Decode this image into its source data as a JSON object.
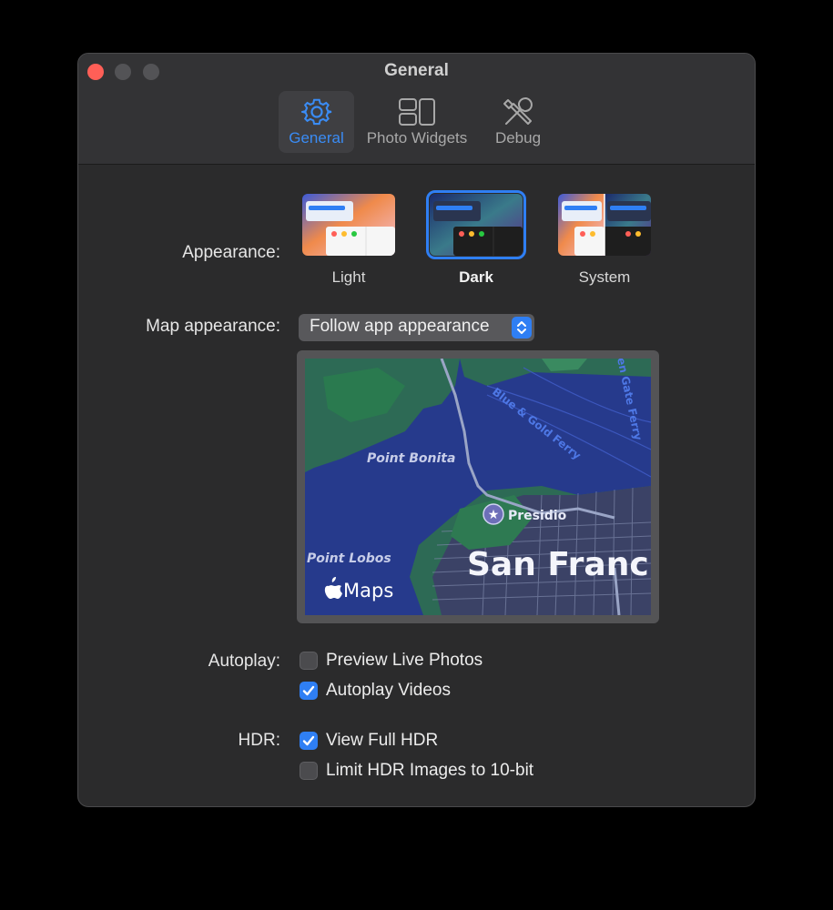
{
  "window": {
    "title": "General"
  },
  "toolbar": {
    "tabs": [
      {
        "label": "General",
        "icon": "gear-icon",
        "active": true
      },
      {
        "label": "Photo Widgets",
        "icon": "widgets-icon",
        "active": false
      },
      {
        "label": "Debug",
        "icon": "wrench-screwdriver-icon",
        "active": false
      }
    ]
  },
  "appearance": {
    "label": "Appearance:",
    "options": [
      {
        "label": "Light",
        "selected": false
      },
      {
        "label": "Dark",
        "selected": true
      },
      {
        "label": "System",
        "selected": false
      }
    ]
  },
  "map_appearance": {
    "label": "Map appearance:",
    "value": "Follow app appearance",
    "preview": {
      "place_labels": [
        "Point Bonita",
        "Point Lobos",
        "Presidio",
        "San Franci"
      ],
      "route_labels": [
        "Blue & Gold Ferry",
        "en Gate Ferry"
      ],
      "brand": "Maps"
    }
  },
  "autoplay": {
    "label": "Autoplay:",
    "options": [
      {
        "label": "Preview Live Photos",
        "checked": false
      },
      {
        "label": "Autoplay Videos",
        "checked": true
      }
    ]
  },
  "hdr": {
    "label": "HDR:",
    "options": [
      {
        "label": "View Full HDR",
        "checked": true
      },
      {
        "label": "Limit HDR Images to 10-bit",
        "checked": false
      }
    ]
  },
  "colors": {
    "accent": "#2f7ff4",
    "close": "#ff5f57",
    "window_bg": "#2b2b2c",
    "map_water": "#263a8c",
    "map_land": "#2d6a55"
  }
}
